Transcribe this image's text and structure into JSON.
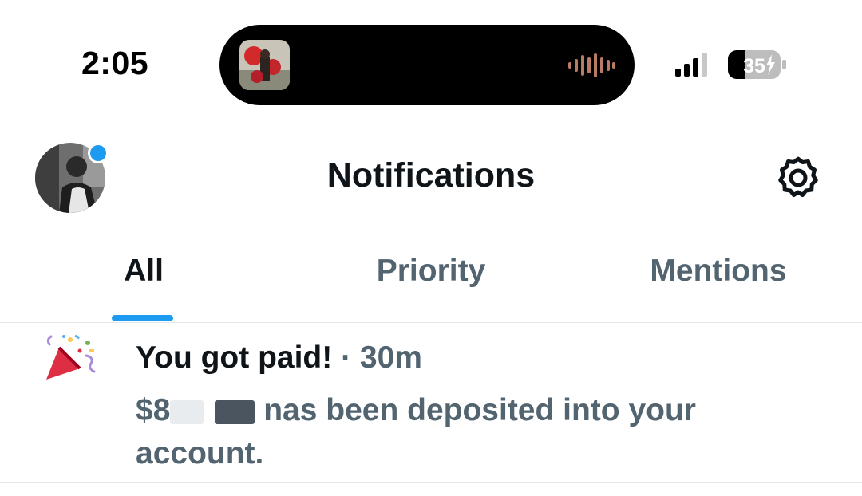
{
  "status_bar": {
    "time": "2:05",
    "battery_level": "35"
  },
  "header": {
    "title": "Notifications"
  },
  "tabs": [
    {
      "label": "All",
      "active": true
    },
    {
      "label": "Priority",
      "active": false
    },
    {
      "label": "Mentions",
      "active": false
    }
  ],
  "notification": {
    "icon": "party-popper-icon",
    "title": "You got paid!",
    "separator": "·",
    "time": "30m",
    "body_prefix": "$8",
    "body_suffix": "nas been deposited into your account."
  },
  "colors": {
    "accent": "#1d9bf0",
    "text_primary": "#0f1419",
    "text_secondary": "#536471"
  }
}
